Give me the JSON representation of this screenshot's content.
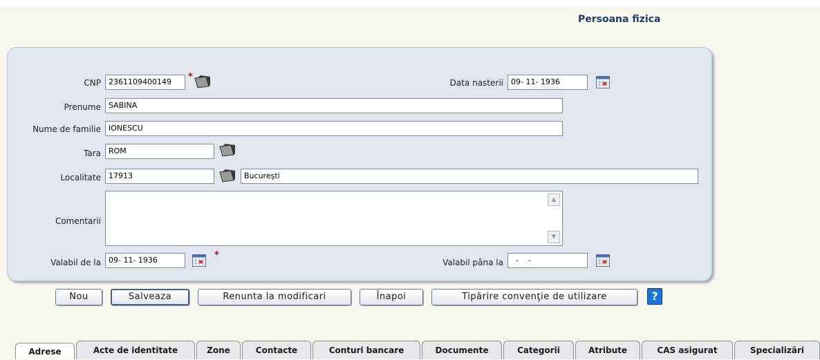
{
  "page_title": "Persoana fizica",
  "form": {
    "cnp": {
      "label": "CNP",
      "value": "2361109400149",
      "required_mark": "*"
    },
    "data_nasterii": {
      "label": "Data nasterii",
      "value": "09- 11-  1936"
    },
    "prenume": {
      "label": "Prenume",
      "value": "SABINA"
    },
    "nume_familie": {
      "label": "Nume de familie",
      "value": "IONESCU"
    },
    "tara": {
      "label": "Tara",
      "value": "ROM"
    },
    "localitate": {
      "label": "Localitate",
      "code": "17913",
      "name": "Bucureşti"
    },
    "comentarii": {
      "label": "Comentarii",
      "value": ""
    },
    "valabil_de_la": {
      "label": "Valabil de la",
      "value": "09- 11-  1936",
      "required_mark": "*"
    },
    "valabil_pana_la": {
      "label": "Valabil pâna la",
      "value": "  -    -  "
    }
  },
  "buttons": {
    "nou": "Nou",
    "salveaza": "Salveaza",
    "renunta": "Renunta la modificari",
    "inapoi": "Înapoi",
    "tiparire": "Tipărire convenţie de utilizare",
    "help": "?"
  },
  "tabs": [
    "Adrese",
    "Acte de identitate",
    "Zone",
    "Contacte",
    "Conturi bancare",
    "Documente",
    "Categorii",
    "Atribute",
    "CAS asigurat",
    "Specializări"
  ],
  "active_tab": "Adrese",
  "icons": [
    "folder-lookup-icon",
    "calendar-icon",
    "help-icon"
  ],
  "colors": {
    "title": "#1f3f70",
    "panel": "#e2e6ee",
    "required": "#d40000",
    "help": "#1c73d8"
  }
}
